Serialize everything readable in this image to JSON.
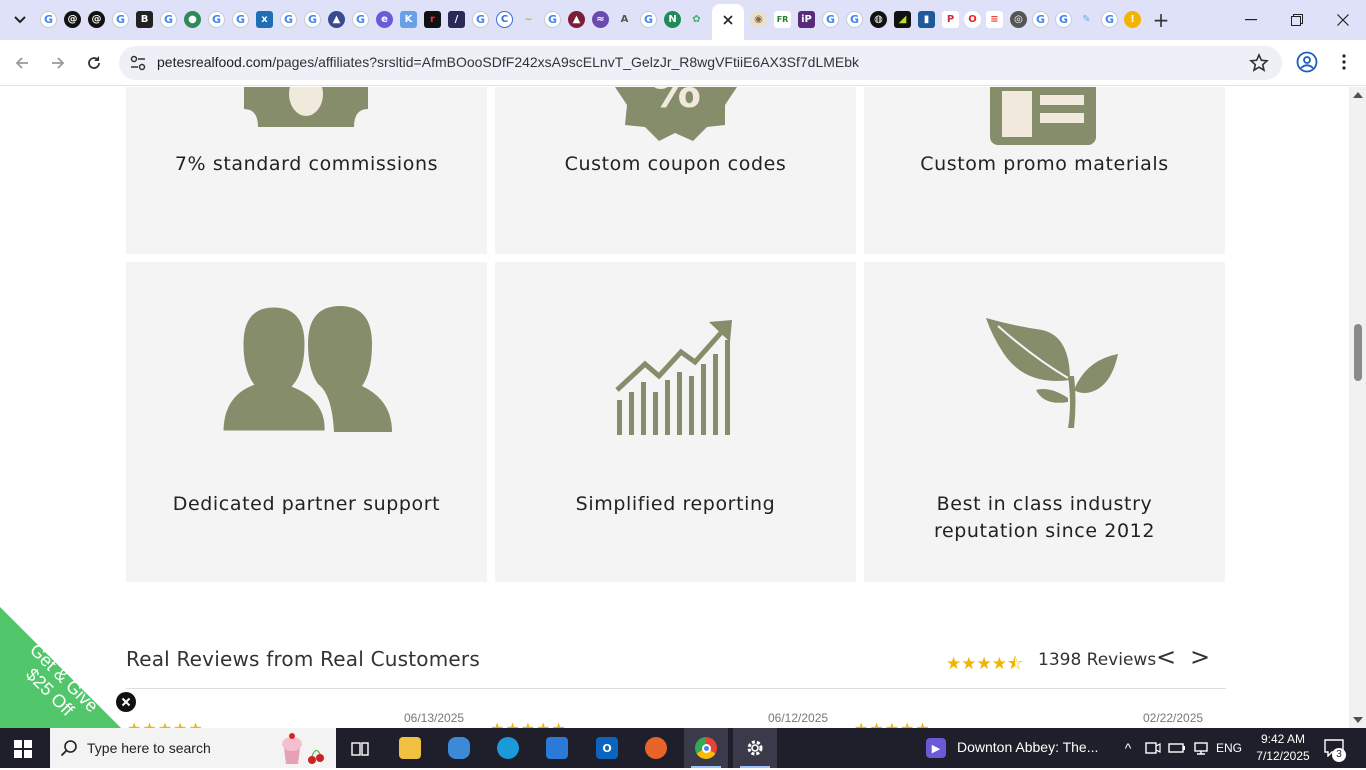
{
  "browser": {
    "url_host": "petesrealfood.com",
    "url_path": "/pages/affiliates?srsltid=AfmBOooSDfF242xsA9scELnvT_GelzJr_R8wgVFtiiE6AX3Sf7dLMEbk",
    "new_tab_label": "+",
    "favicon_letters": [
      "G",
      "",
      "",
      "G",
      "B",
      "G",
      "",
      "G",
      "G",
      "x",
      "G",
      "G",
      "",
      "G",
      "",
      "K",
      "r",
      "",
      "G",
      "",
      "",
      "G",
      "",
      "",
      "",
      "G",
      "",
      "",
      "",
      "",
      "",
      "",
      "",
      "G",
      "G",
      "",
      "",
      "",
      "",
      "",
      "",
      "",
      "",
      "",
      "G",
      "G",
      "",
      "G",
      "!"
    ]
  },
  "page": {
    "cards": [
      {
        "label": "7% standard commissions",
        "icon": "money-icon"
      },
      {
        "label": "Custom coupon codes",
        "icon": "discount-badge-icon"
      },
      {
        "label": "Custom promo materials",
        "icon": "newspaper-icon"
      },
      {
        "label": "Dedicated partner support",
        "icon": "people-icon"
      },
      {
        "label": "Simplified reporting",
        "icon": "growth-chart-icon"
      },
      {
        "label": "Best in class industry reputation since 2012",
        "icon": "plant-icon"
      }
    ],
    "coupon_icon_text": "%",
    "reviews": {
      "title": "Real Reviews from Real Customers",
      "stars": "★★★★⯪",
      "count_label": "1398 Reviews",
      "prev": "<",
      "next": ">",
      "dates": [
        "06/13/2025",
        "06/12/2025",
        "02/22/2025"
      ],
      "review_stars": "★★★★★"
    },
    "promo": {
      "line1": "Get & Give",
      "line2": "$25 Off"
    }
  },
  "taskbar": {
    "search_placeholder": "Type here to search",
    "media_title": "Downton Abbey: The...",
    "language": "ENG",
    "time": "9:42 AM",
    "date": "7/12/2025",
    "notifications": "3"
  },
  "colors": {
    "icon_olive": "#868d6a",
    "card_bg": "#f4f4f4",
    "promo_green": "#52c66a",
    "star_gold": "#f2b400"
  }
}
